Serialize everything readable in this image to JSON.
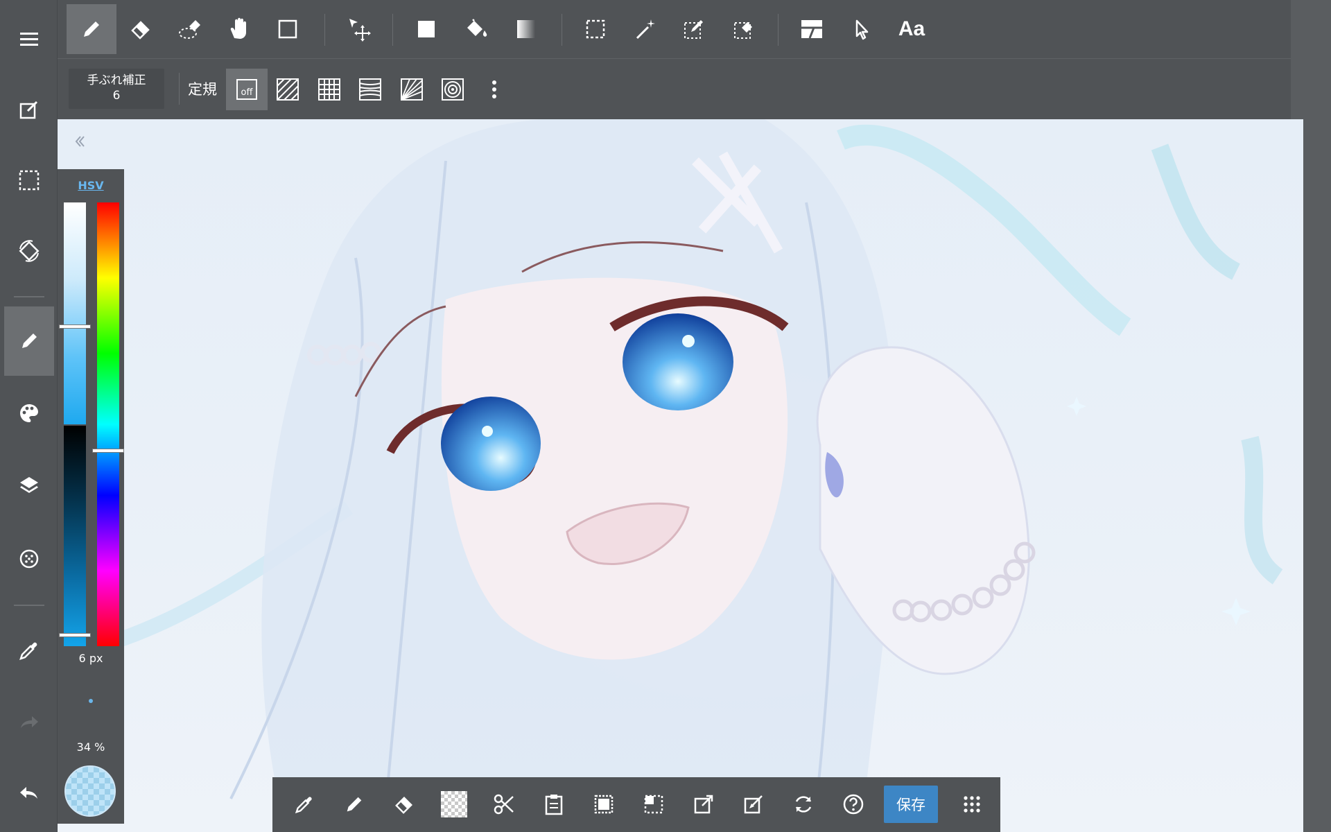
{
  "top_toolbar": {
    "tools": [
      {
        "icon": "pen-icon",
        "active": true
      },
      {
        "icon": "eraser-icon"
      },
      {
        "icon": "blur-eraser-icon"
      },
      {
        "icon": "hand-icon"
      },
      {
        "icon": "shape-icon"
      },
      {
        "icon": "move-icon"
      },
      {
        "icon": "fill-icon"
      },
      {
        "icon": "bucket-icon"
      },
      {
        "icon": "gradient-icon"
      },
      {
        "icon": "select-icon"
      },
      {
        "icon": "magic-wand-icon"
      },
      {
        "icon": "select-pen-icon"
      },
      {
        "icon": "select-eraser-icon"
      },
      {
        "icon": "frame-divider-icon"
      },
      {
        "icon": "pointer-icon"
      }
    ],
    "text_tool_label": "Aa"
  },
  "sub_toolbar": {
    "stabilizer_label": "手ぶれ補正",
    "stabilizer_value": "6",
    "ruler_label": "定規",
    "ruler_off_label": "off"
  },
  "left_sidebar": {
    "items": [
      {
        "icon": "menu-icon"
      },
      {
        "icon": "edit-icon"
      },
      {
        "icon": "selection-icon"
      },
      {
        "icon": "rotate-icon"
      },
      {
        "icon": "brush-icon",
        "active": true
      },
      {
        "icon": "palette-icon"
      },
      {
        "icon": "layers-icon"
      },
      {
        "icon": "material-icon"
      },
      {
        "icon": "eyedropper-icon"
      },
      {
        "icon": "redo-icon"
      },
      {
        "icon": "undo-icon"
      }
    ]
  },
  "color_panel": {
    "mode_label": "HSV",
    "brush_size": "6 px",
    "opacity": "34 %",
    "value_level": 0.28,
    "hue_level": 0.56,
    "current_color": "#cde9f8"
  },
  "bottom_toolbar": {
    "items": [
      {
        "icon": "eyedropper-icon"
      },
      {
        "icon": "pen-icon"
      },
      {
        "icon": "eraser-icon"
      },
      {
        "icon": "transparent-icon"
      },
      {
        "icon": "cut-icon"
      },
      {
        "icon": "paste-icon"
      },
      {
        "icon": "select-all-icon"
      },
      {
        "icon": "deselect-icon"
      },
      {
        "icon": "export-icon"
      },
      {
        "icon": "export-alt-icon"
      },
      {
        "icon": "refresh-icon"
      },
      {
        "icon": "help-icon"
      },
      {
        "icon": "grid-menu-icon"
      }
    ],
    "save_label": "保存"
  },
  "colors": {
    "toolbar_bg": "#505356",
    "active_tool": "#6e7174",
    "save_button": "#3d86c5",
    "hsv_link": "#69b7ef"
  }
}
